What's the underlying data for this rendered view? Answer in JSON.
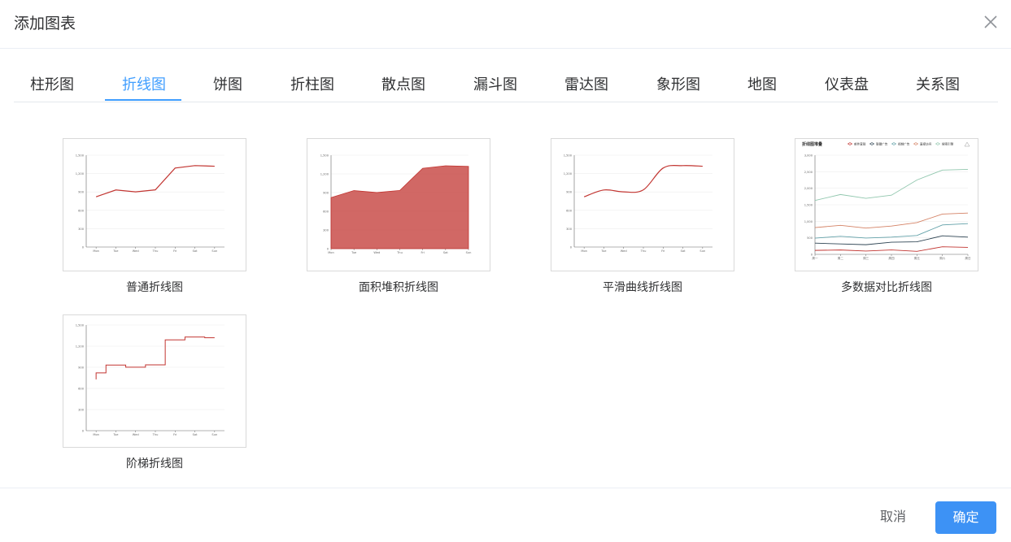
{
  "dialog": {
    "title": "添加图表",
    "close_icon": "close-icon"
  },
  "tabs": [
    {
      "label": "柱形图"
    },
    {
      "label": "折线图",
      "active": true
    },
    {
      "label": "饼图"
    },
    {
      "label": "折柱图"
    },
    {
      "label": "散点图"
    },
    {
      "label": "漏斗图"
    },
    {
      "label": "雷达图"
    },
    {
      "label": "象形图"
    },
    {
      "label": "地图"
    },
    {
      "label": "仪表盘"
    },
    {
      "label": "关系图"
    }
  ],
  "charts": [
    {
      "label": "普通折线图"
    },
    {
      "label": "面积堆积折线图"
    },
    {
      "label": "平滑曲线折线图"
    },
    {
      "label": "多数据对比折线图"
    },
    {
      "label": "阶梯折线图"
    }
  ],
  "thumb": {
    "days": [
      "Mon",
      "Tue",
      "Wed",
      "Thu",
      "Fri",
      "Sat",
      "Sun"
    ],
    "y_ticks": [
      "0",
      "300",
      "600",
      "900",
      "1,200",
      "1,500"
    ],
    "values": [
      820,
      932,
      901,
      934,
      1290,
      1330,
      1320
    ],
    "multi_title": "折线图堆叠",
    "multi_legend": [
      "邮件营销",
      "联盟广告",
      "视频广告",
      "直接访问",
      "搜索引擎"
    ],
    "multi_days": [
      "周一",
      "周二",
      "周三",
      "周四",
      "周五",
      "周六",
      "周日"
    ],
    "multi_y_ticks": [
      "0",
      "500",
      "1,000",
      "1,500",
      "2,000",
      "2,500",
      "3,000"
    ],
    "multi_series": [
      {
        "values": [
          120,
          132,
          101,
          134,
          90,
          230,
          210
        ],
        "color": "#c23531"
      },
      {
        "values": [
          220,
          182,
          191,
          234,
          290,
          330,
          310
        ],
        "color": "#2f4554"
      },
      {
        "values": [
          150,
          232,
          201,
          154,
          190,
          330,
          410
        ],
        "color": "#61a0a8"
      },
      {
        "values": [
          320,
          332,
          301,
          334,
          390,
          330,
          320
        ],
        "color": "#d48265"
      },
      {
        "values": [
          820,
          932,
          901,
          934,
          1290,
          1330,
          1320
        ],
        "color": "#91c7ae"
      }
    ],
    "line_color": "#c23531"
  },
  "footer": {
    "cancel_label": "取消",
    "confirm_label": "确定",
    "confirm_color": "#3d92f5"
  }
}
